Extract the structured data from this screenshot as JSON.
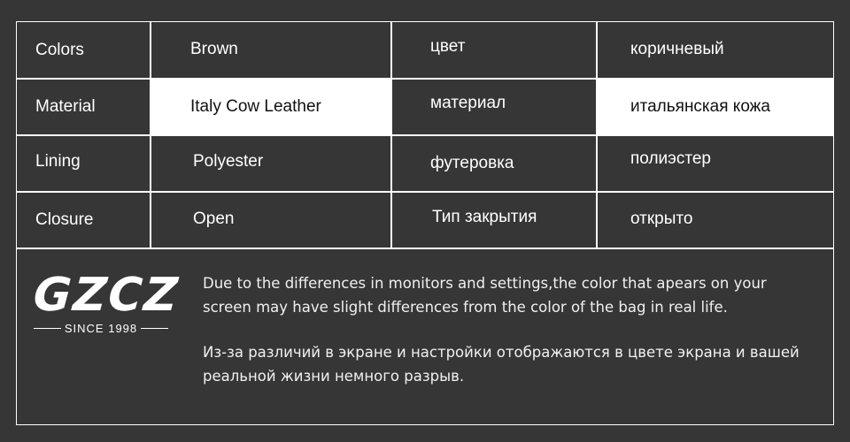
{
  "table": {
    "rows": [
      {
        "label": "Colors",
        "value_en": "Brown",
        "label_ru": "цвет",
        "value_ru": "коричневый",
        "highlight": false
      },
      {
        "label": "Material",
        "value_en": "Italy Cow Leather",
        "label_ru": "материал",
        "value_ru": "итальянская кожа",
        "highlight": true
      },
      {
        "label": "Lining",
        "value_en": "Polyester",
        "label_ru": "футеровка",
        "value_ru": "полиэстер",
        "highlight": false
      },
      {
        "label": "Closure",
        "value_en": "Open",
        "label_ru": "Тип закрытия",
        "value_ru": "открыто",
        "highlight": false
      }
    ]
  },
  "logo": {
    "brand": "GZCZ",
    "tagline": "SINCE 1998"
  },
  "disclaimer": {
    "en": "Due to the differences in monitors and settings,the color that apears on your screen may have slight differences from the color of the bag in real life.",
    "ru": "Из-за различий в экране и настройки отображаются в цвете экрана и вашей реальной жизни немного разрыв."
  },
  "colors": {
    "background": "#363636",
    "border": "#ffffff",
    "highlight_cell": "#ffffff"
  }
}
